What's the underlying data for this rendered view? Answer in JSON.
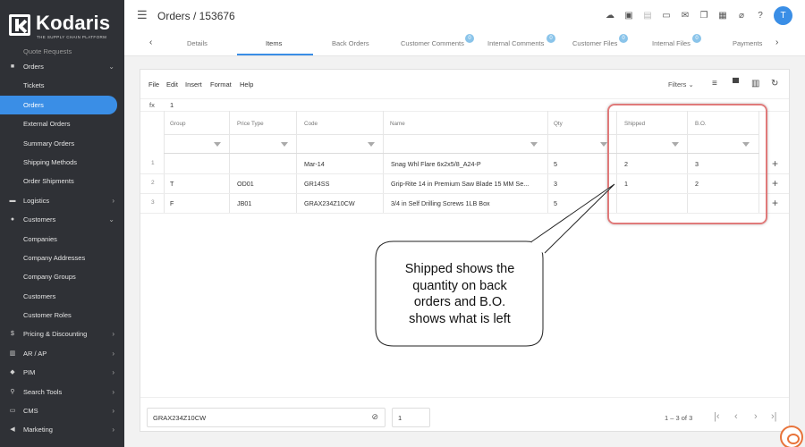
{
  "brand": {
    "name": "Kodaris",
    "tagline": "THE SUPPLY CHAIN PLATFORM"
  },
  "sidebar": {
    "cut_item": "Quote Requests",
    "items": [
      {
        "label": "Orders",
        "icon": "truck-icon",
        "chevron": "⌄",
        "top": true
      },
      {
        "label": "Tickets"
      },
      {
        "label": "Orders",
        "active": true
      },
      {
        "label": "External Orders"
      },
      {
        "label": "Summary Orders"
      },
      {
        "label": "Shipping Methods"
      },
      {
        "label": "Order Shipments"
      },
      {
        "label": "Logistics",
        "icon": "truck-icon",
        "chevron": "›",
        "top": true
      },
      {
        "label": "Customers",
        "icon": "users-icon",
        "chevron": "⌄",
        "top": true
      },
      {
        "label": "Companies"
      },
      {
        "label": "Company Addresses"
      },
      {
        "label": "Company Groups"
      },
      {
        "label": "Customers"
      },
      {
        "label": "Customer Roles"
      },
      {
        "label": "Pricing & Discounting",
        "icon": "dollar-icon",
        "chevron": "›",
        "top": true
      },
      {
        "label": "AR / AP",
        "icon": "bank-icon",
        "chevron": "›",
        "top": true
      },
      {
        "label": "PIM",
        "icon": "tag-icon",
        "chevron": "›",
        "top": true
      },
      {
        "label": "Search Tools",
        "icon": "search-icon",
        "chevron": "›",
        "top": true
      },
      {
        "label": "CMS",
        "icon": "monitor-icon",
        "chevron": "›",
        "top": true
      },
      {
        "label": "Marketing",
        "icon": "megaphone-icon",
        "chevron": "›",
        "top": true
      }
    ]
  },
  "header": {
    "title": "Orders / 153676",
    "avatar_initial": "T"
  },
  "tabs": [
    {
      "label": "Details"
    },
    {
      "label": "Items",
      "active": true
    },
    {
      "label": "Back Orders"
    },
    {
      "label": "Customer Comments",
      "badge": "0"
    },
    {
      "label": "Internal Comments",
      "badge": "0"
    },
    {
      "label": "Customer Files",
      "badge": "0"
    },
    {
      "label": "Internal Files",
      "badge": "0"
    },
    {
      "label": "Payments"
    }
  ],
  "menubar": {
    "file": "File",
    "edit": "Edit",
    "insert": "Insert",
    "format": "Format",
    "help": "Help",
    "filters": "Filters"
  },
  "formula": {
    "label": "fx",
    "value": "1"
  },
  "grid": {
    "columns": [
      "Group",
      "Price Type",
      "Code",
      "Name",
      "Qty",
      "Shipped",
      "B.O."
    ],
    "rows": [
      {
        "num": "1",
        "group": "",
        "price_type": "",
        "code": "Mar-14",
        "name": "Snag Whl Flare 6x2x5/8_A24-P",
        "qty": "5",
        "shipped": "2",
        "bo": "3"
      },
      {
        "num": "2",
        "group": "T",
        "price_type": "OD01",
        "code": "GR14SS",
        "name": "Grip-Rite 14 in Premium Saw Blade 15 MM Se...",
        "qty": "3",
        "shipped": "1",
        "bo": "2"
      },
      {
        "num": "3",
        "group": "F",
        "price_type": "JB01",
        "code": "GRAX234Z10CW",
        "name": "3/4 in Self Drilling Screws 1LB Box",
        "qty": "5",
        "shipped": "",
        "bo": ""
      }
    ]
  },
  "callout": {
    "lines": [
      "Shipped shows the",
      "quantity on back",
      "orders and B.O.",
      "shows what is left"
    ]
  },
  "footer": {
    "sku": "GRAX234Z10CW",
    "qty": "1",
    "page_info": "1 – 3 of 3"
  },
  "colors": {
    "accent": "#3a8ee6",
    "sidebar_bg": "#2f3136",
    "highlight": "#e07a7a"
  }
}
